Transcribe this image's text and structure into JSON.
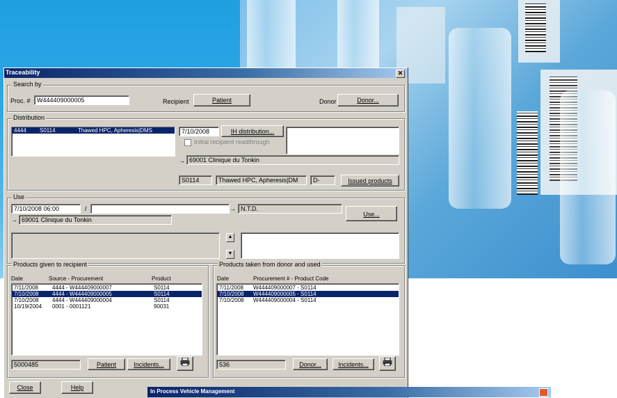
{
  "window": {
    "title": "Traceability",
    "close_glyph": "✕"
  },
  "search": {
    "legend": "Search by",
    "proc_label": "Proc. #",
    "proc_value": "W444409000005",
    "recipient_label": "Recipient",
    "patient_button": "Patient",
    "donor_label": "Donor",
    "donor_button": "Donor..."
  },
  "distribution": {
    "legend": "Distribution",
    "rows": [
      {
        "code": "4444",
        "product": "S0114",
        "desc": "Thawed HPC, Apheresis|DMS"
      }
    ],
    "date": "7/10/2008",
    "ih_button": "IH distribution...",
    "checkbox_label": "Initial recipient readthrough",
    "arrow": "→",
    "clinic": "69001 Clinique du Tonkin",
    "product_code": "S0114",
    "product_desc": "Thawed HPC, Apheresis|DM",
    "suffix": "D-",
    "issued_button": "Issued products"
  },
  "use": {
    "legend": "Use",
    "datetime": "7/10/2008 06:00",
    "slash": "/",
    "arrow1": "→",
    "result": "N.T.D.",
    "use_button": "Use...",
    "arrow2": "→",
    "clinic": "69001 Clinique du Tonkin"
  },
  "products_given": {
    "legend": "Products given to recipient",
    "headers": {
      "date": "Date",
      "source": "Source - Procurement",
      "product": "Product"
    },
    "rows": [
      {
        "date": "7/11/2008",
        "source": "4444 - W444409000007",
        "product": "S0114",
        "selected": false
      },
      {
        "date": "7/10/2008",
        "source": "4444 - W444409000005",
        "product": "S0114",
        "selected": true
      },
      {
        "date": "7/10/2008",
        "source": "4444 - W444409000004",
        "product": "S0114",
        "selected": false
      },
      {
        "date": "10/19/2004",
        "source": "0001 - 0001121",
        "product": "90031",
        "selected": false
      }
    ],
    "footer_value": "5000485",
    "patient_button": "Patient",
    "incidents_button": "Incidents..."
  },
  "products_taken": {
    "legend": "Products taken from donor and used",
    "headers": {
      "date": "Date",
      "proc": "Procurement # - Product Code"
    },
    "rows": [
      {
        "date": "7/11/2008",
        "proc": "W444409000007 - S0114",
        "selected": false
      },
      {
        "date": "7/10/2008",
        "proc": "W444409000005 - S0114",
        "selected": true
      },
      {
        "date": "7/10/2008",
        "proc": "W444409000004 - S0114",
        "selected": false
      }
    ],
    "footer_value": "536",
    "donor_button": "Donor...",
    "incidents_button": "Incidents..."
  },
  "footer": {
    "close_button": "Close",
    "help_button": "Help"
  },
  "second_window": {
    "title": "In Process Vehicle Management"
  },
  "colors": {
    "title_start": "#0a246a",
    "title_end": "#a6caf0",
    "selection": "#0a246a",
    "face": "#d4d0c8"
  }
}
